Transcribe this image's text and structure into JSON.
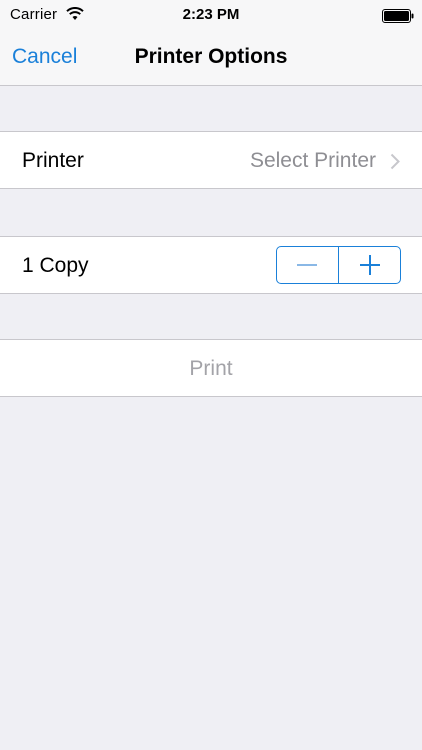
{
  "status_bar": {
    "carrier": "Carrier",
    "time": "2:23 PM",
    "wifi_icon": "wifi-icon",
    "battery_icon": "battery-icon"
  },
  "nav": {
    "cancel_label": "Cancel",
    "title": "Printer Options"
  },
  "printer_cell": {
    "label": "Printer",
    "value": "Select Printer",
    "icon": "chevron-right-icon"
  },
  "copies_cell": {
    "label": "1 Copy",
    "copies": 1,
    "decrement_icon": "minus-icon",
    "increment_icon": "plus-icon"
  },
  "print_cell": {
    "label": "Print",
    "enabled": false
  },
  "colors": {
    "accent": "#1a80d9",
    "background": "#efeff4",
    "secondary_text": "#8e8e93",
    "disabled_text": "#a3a3a8"
  }
}
